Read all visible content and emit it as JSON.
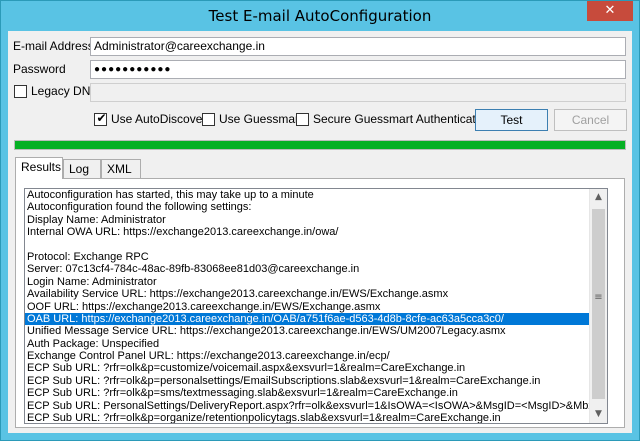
{
  "window": {
    "title": "Test E-mail AutoConfiguration",
    "close_glyph": "✕"
  },
  "form": {
    "email_label": "E-mail Address",
    "email_value": "Administrator@careexchange.in",
    "password_label": "Password",
    "password_value": "●●●●●●●●●●●",
    "legacy_dn_label": "Legacy DN",
    "legacy_dn_checked": false,
    "legacy_dn_value": ""
  },
  "options": {
    "use_autodiscover": {
      "label": "Use AutoDiscover",
      "checked": true
    },
    "use_guessmart": {
      "label": "Use Guessmart",
      "checked": false
    },
    "secure_guessmart": {
      "label": "Secure Guessmart Authentication",
      "checked": false
    }
  },
  "buttons": {
    "test": "Test",
    "cancel": "Cancel"
  },
  "progress": {
    "value": 1.0,
    "color": "#06b025"
  },
  "tabs": [
    {
      "label": "Results",
      "active": true
    },
    {
      "label": "Log",
      "active": false
    },
    {
      "label": "XML",
      "active": false
    }
  ],
  "results": {
    "selected_index": 10,
    "lines": [
      "Autoconfiguration has started, this may take up to a minute",
      "Autoconfiguration found the following settings:",
      "Display Name: Administrator",
      "Internal OWA URL: https://exchange2013.careexchange.in/owa/",
      "",
      "Protocol: Exchange RPC",
      "Server: 07c13cf4-784c-48ac-89fb-83068ee81d03@careexchange.in",
      "Login Name: Administrator",
      "Availability Service URL: https://exchange2013.careexchange.in/EWS/Exchange.asmx",
      "OOF URL: https://exchange2013.careexchange.in/EWS/Exchange.asmx",
      "OAB URL: https://exchange2013.careexchange.in/OAB/a751f6ae-d563-4d8b-8cfe-ac63a5cca3c0/",
      "Unified Message Service URL: https://exchange2013.careexchange.in/EWS/UM2007Legacy.asmx",
      "Auth Package: Unspecified",
      "Exchange Control Panel URL: https://exchange2013.careexchange.in/ecp/",
      "ECP Sub URL: ?rfr=olk&p=customize/voicemail.aspx&exsvurl=1&realm=CareExchange.in",
      "ECP Sub URL: ?rfr=olk&p=personalsettings/EmailSubscriptions.slab&exsvurl=1&realm=CareExchange.in",
      "ECP Sub URL: ?rfr=olk&p=sms/textmessaging.slab&exsvurl=1&realm=CareExchange.in",
      "ECP Sub URL: PersonalSettings/DeliveryReport.aspx?rfr=olk&exsvurl=1&IsOWA=<IsOWA>&MsgID=<MsgID>&Mbx=<Mbx>&",
      "ECP Sub URL: ?rfr=olk&p=organize/retentionpolicytags.slab&exsvurl=1&realm=CareExchange.in"
    ]
  },
  "scrollbar": {
    "up_glyph": "▲",
    "down_glyph": "▼",
    "grip_glyph": "≡"
  }
}
